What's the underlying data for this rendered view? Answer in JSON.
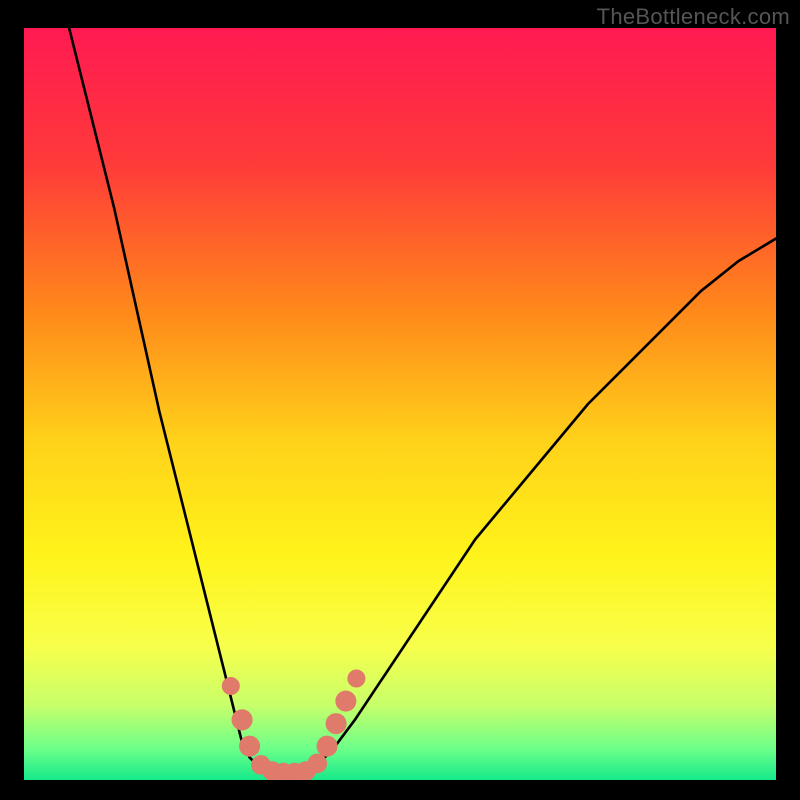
{
  "watermark": "TheBottleneck.com",
  "chart_data": {
    "type": "line",
    "title": "",
    "xlabel": "",
    "ylabel": "",
    "xlim": [
      0,
      100
    ],
    "ylim": [
      0,
      100
    ],
    "gradient_stops": [
      {
        "offset": 0.0,
        "color": "#ff1a52"
      },
      {
        "offset": 0.18,
        "color": "#ff3a3a"
      },
      {
        "offset": 0.38,
        "color": "#ff8a1a"
      },
      {
        "offset": 0.55,
        "color": "#ffd21a"
      },
      {
        "offset": 0.7,
        "color": "#fff31a"
      },
      {
        "offset": 0.82,
        "color": "#f8ff4a"
      },
      {
        "offset": 0.9,
        "color": "#c8ff6a"
      },
      {
        "offset": 0.96,
        "color": "#6aff8a"
      },
      {
        "offset": 1.0,
        "color": "#15e98a"
      }
    ],
    "series": [
      {
        "name": "left-curve",
        "x": [
          6,
          8,
          10,
          12,
          14,
          16,
          18,
          20,
          22,
          24,
          26,
          27,
          28,
          29,
          30,
          31
        ],
        "y": [
          100,
          92,
          84,
          76,
          67,
          58,
          49,
          41,
          33,
          25,
          17,
          13,
          9,
          5,
          3,
          2
        ]
      },
      {
        "name": "floor",
        "x": [
          31,
          33,
          35,
          37,
          39
        ],
        "y": [
          2,
          1,
          1,
          1,
          2
        ]
      },
      {
        "name": "right-curve",
        "x": [
          39,
          41,
          44,
          48,
          52,
          56,
          60,
          65,
          70,
          75,
          80,
          85,
          90,
          95,
          100
        ],
        "y": [
          2,
          4,
          8,
          14,
          20,
          26,
          32,
          38,
          44,
          50,
          55,
          60,
          65,
          69,
          72
        ]
      }
    ],
    "markers": {
      "name": "beads",
      "color": "#e07a6a",
      "points": [
        {
          "x": 27.5,
          "y": 12.5,
          "r": 1.2
        },
        {
          "x": 29.0,
          "y": 8.0,
          "r": 1.4
        },
        {
          "x": 30.0,
          "y": 4.5,
          "r": 1.4
        },
        {
          "x": 31.5,
          "y": 2.0,
          "r": 1.3
        },
        {
          "x": 33.0,
          "y": 1.2,
          "r": 1.3
        },
        {
          "x": 34.5,
          "y": 1.0,
          "r": 1.3
        },
        {
          "x": 36.0,
          "y": 1.0,
          "r": 1.3
        },
        {
          "x": 37.5,
          "y": 1.2,
          "r": 1.3
        },
        {
          "x": 39.0,
          "y": 2.2,
          "r": 1.3
        },
        {
          "x": 40.3,
          "y": 4.5,
          "r": 1.4
        },
        {
          "x": 41.5,
          "y": 7.5,
          "r": 1.4
        },
        {
          "x": 42.8,
          "y": 10.5,
          "r": 1.4
        },
        {
          "x": 44.2,
          "y": 13.5,
          "r": 1.2
        }
      ]
    }
  }
}
